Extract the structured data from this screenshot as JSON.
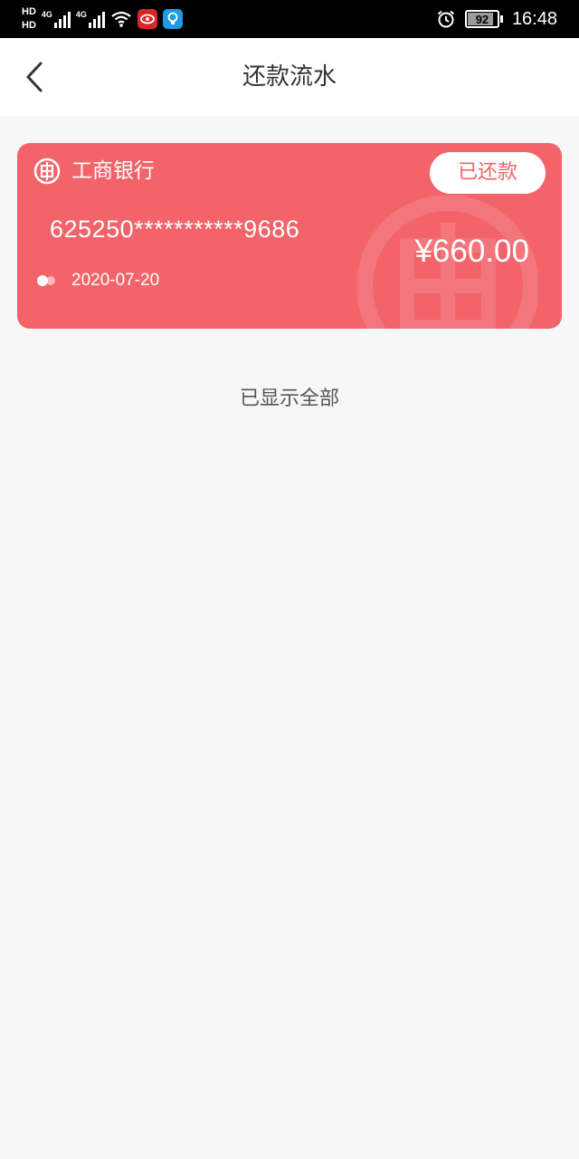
{
  "status_bar": {
    "hd1": "HD",
    "hd2": "HD",
    "net1": "4G",
    "net2": "4G",
    "battery": "92",
    "time": "16:48"
  },
  "header": {
    "title": "还款流水",
    "back_icon": "chevron-left-icon"
  },
  "records": [
    {
      "bank_name": "工商银行",
      "bank_icon": "icbc-logo-icon",
      "card_number": "625250***********9686",
      "date": "2020-07-20",
      "amount": "¥660.00",
      "status": "已还款"
    }
  ],
  "list_end_text": "已显示全部",
  "colors": {
    "card_bg": "#f2636a",
    "page_bg": "#f7f7f7",
    "header_bg": "#ffffff",
    "status_bar_bg": "#000000"
  }
}
